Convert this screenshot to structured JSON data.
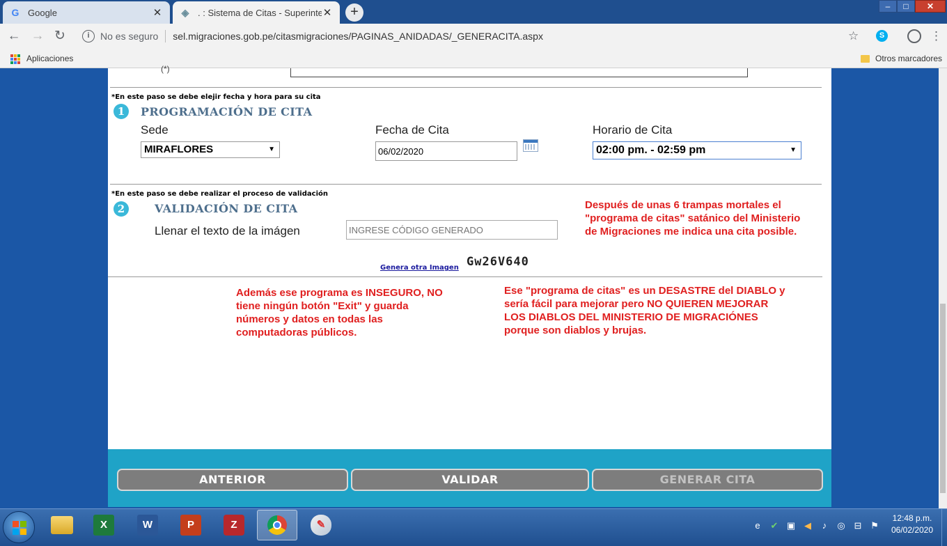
{
  "browser": {
    "tabs": [
      {
        "title": "Google",
        "favicon": "G"
      },
      {
        "title": ". : Sistema de Citas - Superintendencia",
        "favicon": "◈"
      }
    ],
    "new_tab": "+",
    "window_controls": {
      "minimize": "–",
      "maximize": "□",
      "close": "✕"
    },
    "security_label": "No es seguro",
    "url": "sel.migraciones.gob.pe/citasmigraciones/PAGINAS_ANIDADAS/_GENERACITA.aspx",
    "bookmarks": {
      "apps_label": "Aplicaciones",
      "other_label": "Otros marcadores"
    }
  },
  "page": {
    "cut_marker": "(*)",
    "step1": {
      "note": "*En este paso se debe elejir fecha y hora para su cita",
      "number": "1",
      "title": "PROGRAMACIÓN DE CITA",
      "sede_label": "Sede",
      "sede_value": "MIRAFLORES",
      "fecha_label": "Fecha de Cita",
      "fecha_value": "06/02/2020",
      "horario_label": "Horario de Cita",
      "horario_value": "02:00 pm. - 02:59 pm"
    },
    "step2": {
      "note": "*En este paso se debe realizar el proceso de validación",
      "number": "2",
      "title": "VALIDACIÓN DE CITA",
      "captcha_label": "Llenar el texto de la imágen",
      "captcha_placeholder": "INGRESE CÓDIGO GENERADO",
      "new_image_link": "Genera otra Imagen",
      "captcha_text": "Gw26V640"
    },
    "annotations": {
      "top_right": "Después de unas 6 trampas mortales el \"programa de citas\" satánico del Ministerio de Migraciones me indica una cita posible.",
      "bottom_left": "Además ese programa es INSEGURO, NO tiene ningún botón \"Exit\" y guarda números y datos en todas las computadoras públicos.",
      "bottom_right": "Ese \"programa de citas\" es un DESASTRE del DIABLO y sería fácil para mejorar pero NO QUIEREN MEJORAR LOS DIABLOS DEL MINISTERIO DE MIGRACIÓNES porque son diablos y brujas."
    },
    "buttons": {
      "anterior": "ANTERIOR",
      "validar": "VALIDAR",
      "generar": "GENERAR CITA"
    }
  },
  "taskbar": {
    "apps": [
      "explorer",
      "excel",
      "word",
      "powerpoint",
      "filezilla",
      "chrome",
      "paint"
    ],
    "clock_time": "12:48 p.m.",
    "clock_date": "06/02/2020"
  },
  "colors": {
    "accent": "#1fa3c7",
    "annotation_red": "#e02020",
    "step_title": "#4d6e8c"
  }
}
